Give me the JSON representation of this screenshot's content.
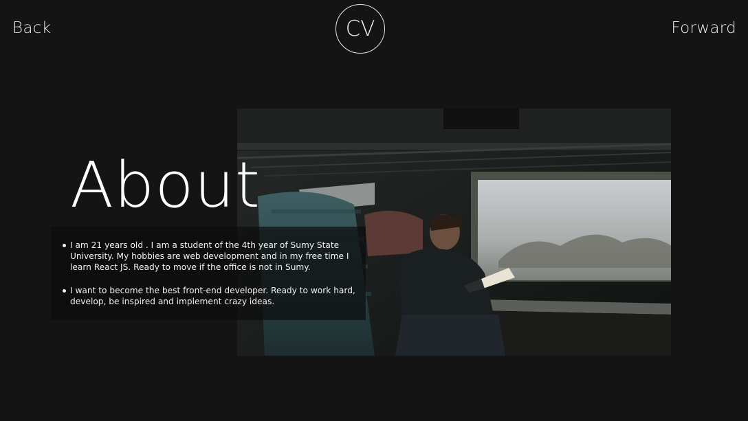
{
  "nav": {
    "back_label": "Back",
    "forward_label": "Forward",
    "logo_text": "CV"
  },
  "main": {
    "title": "About",
    "paragraphs": [
      "I am 21 years old . I am a student of the 4th year of Sumy State University. My hobbies are web development and in my free time I learn React JS. Ready to move if the office is not in Sumy.",
      "I want to become the best front-end developer. Ready to work hard, develop, be inspired and implement crazy ideas."
    ]
  },
  "colors": {
    "background": "#141414",
    "text": "#ffffff"
  }
}
